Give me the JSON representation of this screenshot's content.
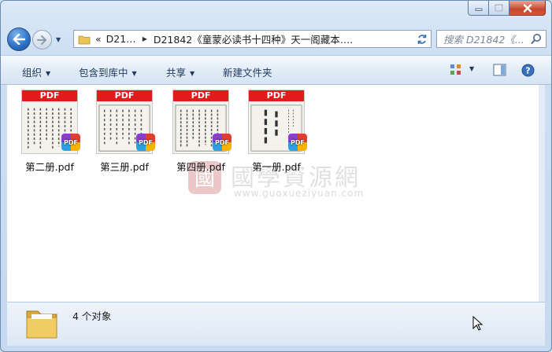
{
  "address": {
    "segments": [
      "«",
      "D21…",
      "D21842《童蒙必读书十四种》天一阁藏本…."
    ],
    "refresh_icon": "refresh-icon"
  },
  "search": {
    "placeholder": "搜索 D21842《..."
  },
  "toolbar": {
    "organize": "组织",
    "include_in_library": "包含到库中",
    "share": "共享",
    "new_folder": "新建文件夹"
  },
  "files": [
    {
      "name": "第二册.pdf",
      "band": "PDF",
      "badge": "PDF"
    },
    {
      "name": "第三册.pdf",
      "band": "PDF",
      "badge": "PDF"
    },
    {
      "name": "第四册.pdf",
      "band": "PDF",
      "badge": "PDF"
    },
    {
      "name": "第一册.pdf",
      "band": "PDF",
      "badge": "PDF"
    }
  ],
  "watermark": {
    "title": "國學資源網",
    "url": "www.guoxueziyuan.com",
    "logo_text": "國"
  },
  "status": {
    "item_count": "4 个对象"
  },
  "colors": {
    "pdf_red": "#e11a1a",
    "accent": "#2a6fc4",
    "close_red": "#c7462c"
  }
}
